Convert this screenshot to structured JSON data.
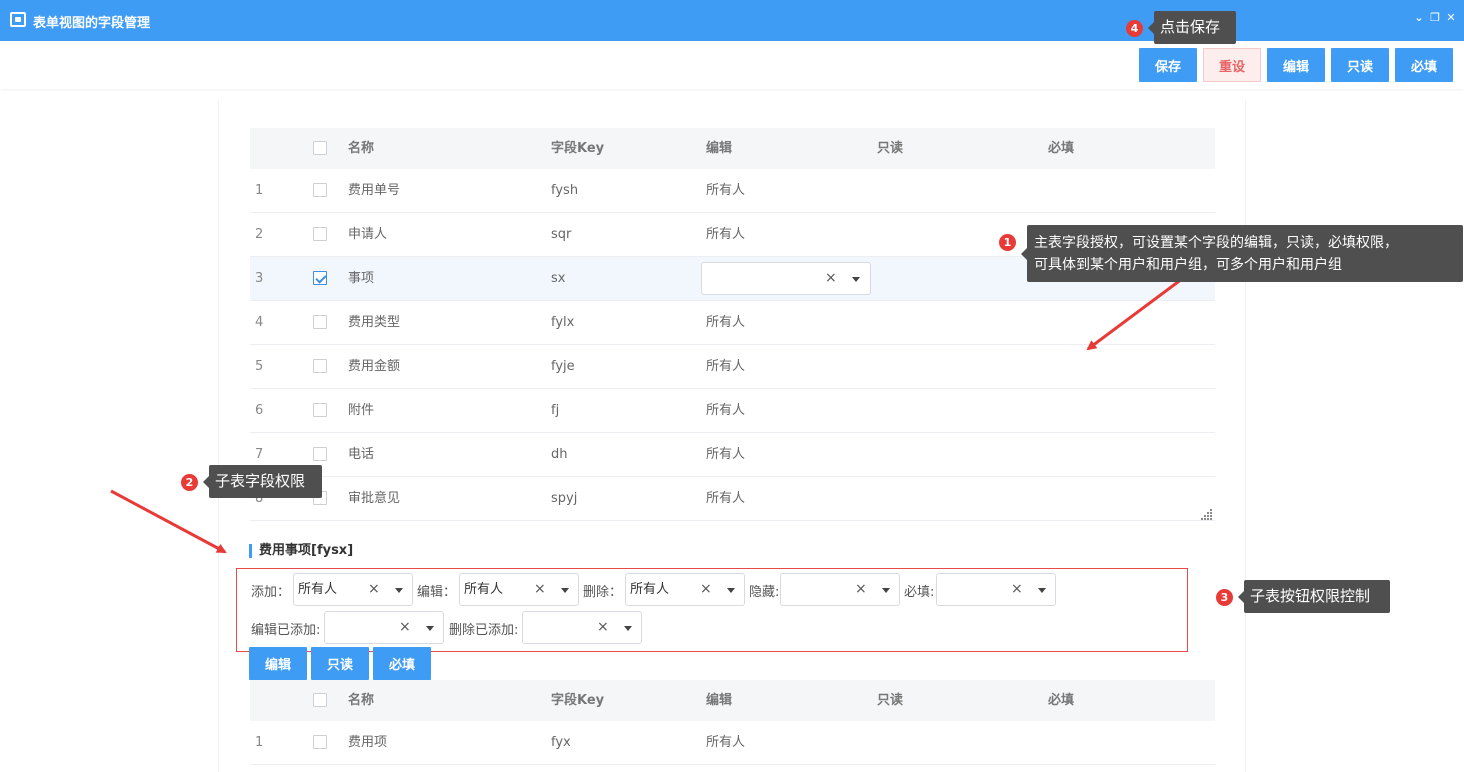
{
  "window": {
    "title": "表单视图的字段管理",
    "controls": [
      "⌄",
      "❐",
      "✕"
    ]
  },
  "toolbar": {
    "save": "保存",
    "reset": "重设",
    "edit": "编辑",
    "readonly": "只读",
    "required": "必填"
  },
  "main_table": {
    "headers": {
      "name": "名称",
      "key": "字段Key",
      "edit": "编辑",
      "readonly": "只读",
      "required": "必填"
    },
    "rows": [
      {
        "num": "1",
        "name": "费用单号",
        "key": "fysh",
        "edit": "所有人",
        "checked": false
      },
      {
        "num": "2",
        "name": "申请人",
        "key": "sqr",
        "edit": "所有人",
        "checked": false
      },
      {
        "num": "3",
        "name": "事项",
        "key": "sx",
        "edit": "",
        "checked": true
      },
      {
        "num": "4",
        "name": "费用类型",
        "key": "fylx",
        "edit": "所有人",
        "checked": false
      },
      {
        "num": "5",
        "name": "费用金额",
        "key": "fyje",
        "edit": "所有人",
        "checked": false
      },
      {
        "num": "6",
        "name": "附件",
        "key": "fj",
        "edit": "所有人",
        "checked": false
      },
      {
        "num": "7",
        "name": "电话",
        "key": "dh",
        "edit": "所有人",
        "checked": false
      },
      {
        "num": "8",
        "name": "审批意见",
        "key": "spyj",
        "edit": "所有人",
        "checked": false
      }
    ],
    "clear_glyph": "×"
  },
  "subtable": {
    "title": "费用事项[fysx]",
    "perms": {
      "add_label": "添加：",
      "add_value": "所有人",
      "edit_label": "编辑：",
      "edit_value": "所有人",
      "delete_label": "删除：",
      "delete_value": "所有人",
      "hide_label": "隐藏:",
      "hide_value": "",
      "required_label": "必填:",
      "required_value": "",
      "edit_added_label": "编辑已添加:",
      "edit_added_value": "",
      "delete_added_label": "删除已添加:",
      "delete_added_value": ""
    },
    "buttons": {
      "edit": "编辑",
      "readonly": "只读",
      "required": "必填"
    },
    "headers": {
      "name": "名称",
      "key": "字段Key",
      "edit": "编辑",
      "readonly": "只读",
      "required": "必填"
    },
    "rows": [
      {
        "num": "1",
        "name": "费用项",
        "key": "fyx",
        "edit": "所有人",
        "checked": false
      }
    ]
  },
  "annotations": {
    "tip1": {
      "badge": "1",
      "line1": "主表字段授权，可设置某个字段的编辑，只读，必填权限，",
      "line2": "可具体到某个用户和用户组，可多个用户和用户组"
    },
    "tip2": {
      "badge": "2",
      "text": "子表字段权限"
    },
    "tip3": {
      "badge": "3",
      "text": "子表按钮权限控制"
    },
    "tip4": {
      "badge": "4",
      "text": "点击保存"
    },
    "arrow_color": "#e83a36"
  },
  "colors": {
    "titlebar": "#3f9cf5",
    "primary_button": "#3f9cf5",
    "reset_text": "#e86464",
    "highlight_box": "#e84a4a"
  }
}
